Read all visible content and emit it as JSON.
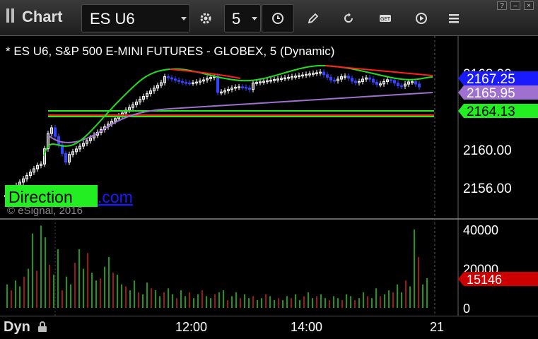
{
  "window": {
    "title": "Chart"
  },
  "toolbar": {
    "symbol": "ES U6",
    "interval": "5",
    "buttons": [
      {
        "name": "studies-gear-icon"
      },
      {
        "name": "clock-icon"
      },
      {
        "name": "pencil-icon"
      },
      {
        "name": "refresh-icon"
      },
      {
        "name": "get-icon"
      },
      {
        "name": "play-icon"
      },
      {
        "name": "menu-icon"
      }
    ]
  },
  "window_controls": [
    "?",
    "–",
    "×"
  ],
  "chart": {
    "legend": "* ES U6, S&P 500 E-MINI FUTURES - GLOBEX, 5 (Dynamic)",
    "watermark_brand": "Direction",
    "watermark_link": ".com",
    "copyright": "© eSignal, 2016",
    "price_ticks": [
      {
        "value": 2168,
        "label": "2168.00"
      },
      {
        "value": 2160,
        "label": "2160.00"
      },
      {
        "value": 2156,
        "label": "2156.00"
      }
    ],
    "volume_ticks": [
      {
        "value": 40000,
        "label": "40000"
      },
      {
        "value": 20000,
        "label": "20000"
      },
      {
        "value": 0,
        "label": "0"
      }
    ],
    "price_markers": [
      {
        "label": "2167.25",
        "value": 2167.25,
        "color": "#1a1aff"
      },
      {
        "label": "2165.95",
        "value": 2165.95,
        "color": "#a070d0"
      },
      {
        "label": "2164.13",
        "value": 2164.13,
        "color": "#22ee22"
      }
    ],
    "volume_marker": {
      "label": "15146",
      "value": 15146,
      "color": "#cc0000"
    },
    "time_labels": [
      {
        "label": "12:00",
        "pos": "12:00"
      },
      {
        "label": "14:00",
        "pos": "14:00"
      },
      {
        "label": "21",
        "pos": "21"
      }
    ],
    "colors": {
      "up": "#ffffff",
      "down": "#3344ff",
      "ema_fast": "#22dd22",
      "ema_slow": "#a070d0",
      "level_red": "#ff2020",
      "level_green": "#22ee22",
      "vol_up": "#22cc22",
      "vol_down": "#cc2222"
    }
  },
  "bottom": {
    "mode_label": "Dyn"
  }
}
